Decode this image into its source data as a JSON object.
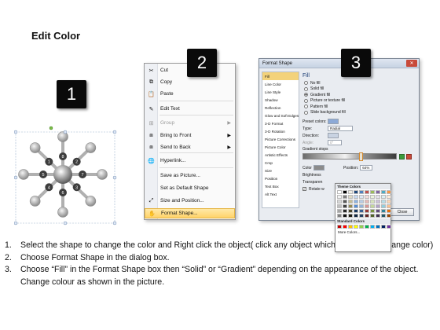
{
  "title": "Edit Color",
  "steps": [
    "1",
    "2",
    "3"
  ],
  "shape": {
    "node_labels": [
      "8",
      "2",
      "7",
      "3",
      "6",
      "4",
      "5",
      "1"
    ]
  },
  "context_menu": {
    "items": [
      {
        "icon": "scissors-icon",
        "glyph": "✂",
        "label": "Cut",
        "arrow": "",
        "disabled": false
      },
      {
        "icon": "copy-icon",
        "glyph": "⧉",
        "label": "Copy",
        "arrow": "",
        "disabled": false
      },
      {
        "icon": "paste-icon",
        "glyph": "📋",
        "label": "Paste",
        "arrow": "",
        "disabled": false
      },
      {
        "icon": "edit-text-icon",
        "glyph": "✎",
        "label": "Edit Text",
        "arrow": "",
        "disabled": false
      },
      {
        "icon": "group-icon",
        "glyph": "⊞",
        "label": "Group",
        "arrow": "▶",
        "disabled": true
      },
      {
        "icon": "bring-front-icon",
        "glyph": "⧈",
        "label": "Bring to Front",
        "arrow": "▶",
        "disabled": false
      },
      {
        "icon": "send-back-icon",
        "glyph": "⧈",
        "label": "Send to Back",
        "arrow": "▶",
        "disabled": false
      },
      {
        "icon": "hyperlink-icon",
        "glyph": "🌐",
        "label": "Hyperlink...",
        "arrow": "",
        "disabled": false
      },
      {
        "icon": "",
        "glyph": "",
        "label": "Save as Picture...",
        "arrow": "",
        "disabled": false
      },
      {
        "icon": "",
        "glyph": "",
        "label": "Set as Default Shape",
        "arrow": "",
        "disabled": false
      },
      {
        "icon": "size-position-icon",
        "glyph": "⤢",
        "label": "Size and Position...",
        "arrow": "",
        "disabled": false
      },
      {
        "icon": "format-shape-icon",
        "glyph": "✋",
        "label": "Format Shape...",
        "arrow": "",
        "disabled": false
      }
    ]
  },
  "format_dialog": {
    "title": "Format Shape",
    "close_glyph": "✕",
    "nav_items": [
      "Fill",
      "Line Color",
      "Line Style",
      "Shadow",
      "Reflection",
      "Glow and Soft Edges",
      "3-D Format",
      "3-D Rotation",
      "Picture Corrections",
      "Picture Color",
      "Artistic Effects",
      "Crop",
      "Size",
      "Position",
      "Text Box",
      "Alt Text"
    ],
    "fill_heading": "Fill",
    "fill_options": [
      {
        "label": "No fill",
        "on": false
      },
      {
        "label": "Solid fill",
        "on": false
      },
      {
        "label": "Gradient fill",
        "on": true
      },
      {
        "label": "Picture or texture fill",
        "on": false
      },
      {
        "label": "Pattern fill",
        "on": false
      },
      {
        "label": "Slide background fill",
        "on": false
      }
    ],
    "preset_colors_label": "Preset colors:",
    "type_label": "Type:",
    "type_value": "Radial",
    "direction_label": "Direction:",
    "angle_label": "Angle:",
    "angle_value": "0°",
    "gradient_stops_label": "Gradient stops",
    "color_label": "Color",
    "position_label": "Position:",
    "position_value": "64%",
    "brightness_label": "Brightness",
    "transparency_label": "Transparen",
    "rotate_label": "Rotate w",
    "close_button": "Close",
    "palette": {
      "theme_heading": "Theme Colors",
      "standard_heading": "Standard Colors",
      "more_colors": "More Colors...",
      "theme_colors": [
        "#ffffff",
        "#000000",
        "#eeece1",
        "#1f497d",
        "#4f81bd",
        "#c0504d",
        "#9bbb59",
        "#8064a2",
        "#4bacc6",
        "#f79646",
        "#f2f2f2",
        "#7f7f7f",
        "#ddd9c3",
        "#c6d9f0",
        "#dbe5f1",
        "#f2dcdb",
        "#ebf1dd",
        "#e5e0ec",
        "#dbeef3",
        "#fdeada",
        "#d8d8d8",
        "#595959",
        "#c4bd97",
        "#8db3e2",
        "#b8cce4",
        "#e5b9b7",
        "#d7e3bc",
        "#ccc1d9",
        "#b7dde8",
        "#fbd5b5",
        "#bfbfbf",
        "#3f3f3f",
        "#938953",
        "#548dd4",
        "#95b3d7",
        "#d99694",
        "#c3d69b",
        "#b2a2c7",
        "#92cddc",
        "#fac08f",
        "#a5a5a5",
        "#262626",
        "#494429",
        "#17365d",
        "#366092",
        "#953734",
        "#76923c",
        "#5f497a",
        "#31859b",
        "#e36c09",
        "#7f7f7f",
        "#0c0c0c",
        "#1d1b10",
        "#0f243e",
        "#244061",
        "#632423",
        "#4f6128",
        "#3f3151",
        "#205867",
        "#974806"
      ],
      "standard_colors": [
        "#c00000",
        "#ff0000",
        "#ffc000",
        "#ffff00",
        "#92d050",
        "#00b050",
        "#00b0f0",
        "#0070c0",
        "#002060",
        "#7030a0"
      ]
    }
  },
  "instructions": [
    {
      "num": "1.",
      "text": "Select the shape to change the color and Right click the object( click any object which you want to change color)"
    },
    {
      "num": "2.",
      "text": "Choose Format Shape in the dialog box."
    },
    {
      "num": "3.",
      "text": "Choose “Fill” in the Format Shape box then “Solid” or “Gradient” depending on the appearance of the object. Change colour as shown in the picture."
    }
  ]
}
